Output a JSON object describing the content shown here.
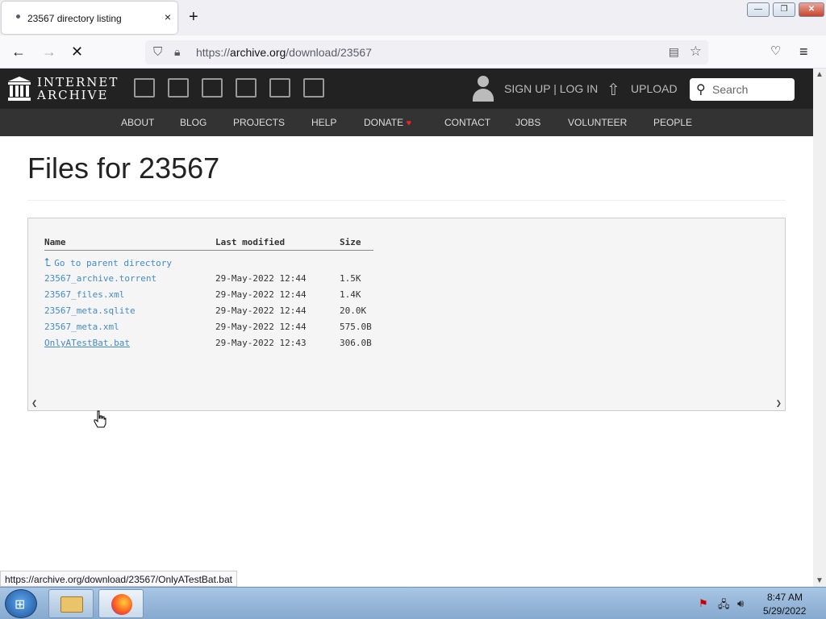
{
  "browser": {
    "tab_title": "23567 directory listing",
    "tab_close": "×",
    "new_tab": "+",
    "url_prefix": "https://",
    "url_host": "archive.org",
    "url_path": "/download/23567",
    "window_controls": {
      "minimize": "—",
      "restore": "❐",
      "close": "✕"
    }
  },
  "ia_header": {
    "logo_line1": "INTERNET",
    "logo_line2": "ARCHIVE",
    "signup_login": "SIGN UP | LOG IN",
    "upload": "UPLOAD",
    "search_placeholder": "Search",
    "media_icons": [
      "web-icon",
      "texts-icon",
      "video-icon",
      "audio-icon",
      "software-icon",
      "images-icon"
    ]
  },
  "ia_menu": [
    "ABOUT",
    "BLOG",
    "PROJECTS",
    "HELP",
    "DONATE",
    "CONTACT",
    "JOBS",
    "VOLUNTEER",
    "PEOPLE"
  ],
  "page": {
    "title": "Files for 23567",
    "columns": {
      "name": "Name",
      "modified": "Last modified",
      "size": "Size"
    },
    "parent_link": "Go to parent directory",
    "files": [
      {
        "name": "23567_archive.torrent",
        "modified": "29-May-2022 12:44",
        "size": "1.5K"
      },
      {
        "name": "23567_files.xml",
        "modified": "29-May-2022 12:44",
        "size": "1.4K"
      },
      {
        "name": "23567_meta.sqlite",
        "modified": "29-May-2022 12:44",
        "size": "20.0K"
      },
      {
        "name": "23567_meta.xml",
        "modified": "29-May-2022 12:44",
        "size": "575.0B"
      },
      {
        "name": "OnlyATestBat.bat",
        "modified": "29-May-2022 12:43",
        "size": "306.0B"
      }
    ]
  },
  "status_url": "https://archive.org/download/23567/OnlyATestBat.bat",
  "taskbar": {
    "time": "8:47 AM",
    "date": "5/29/2022"
  },
  "colors": {
    "ia_dark": "#222222",
    "ia_menu": "#333333",
    "link": "#428bca",
    "donate_heart": "#ee2233"
  }
}
